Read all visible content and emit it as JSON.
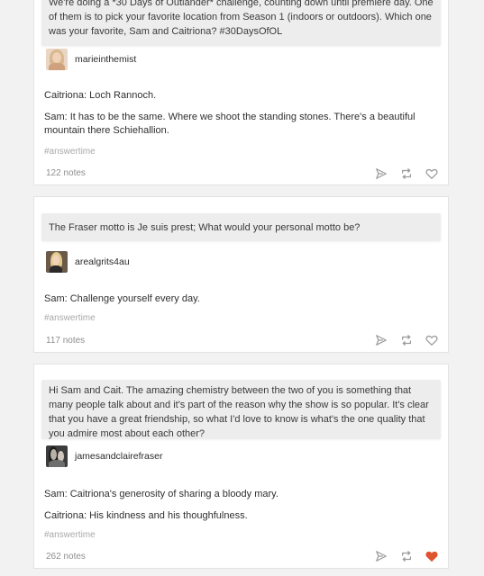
{
  "colors": {
    "background": "#f2f2f2",
    "card": "#ffffff",
    "ask_bubble": "#ededed",
    "tag": "#a8a8a8",
    "icon": "#9a9a9a",
    "liked_heart": "#e0532f"
  },
  "posts": [
    {
      "question": "We're doing a *30 Days of Outlander* challenge, counting down until premiere day. One of them is to pick your favorite location from Season 1 (indoors or outdoors). Which one was your favorite, Sam and Caitriona? #30DaysOfOL",
      "asker": "marieinthemist",
      "answers": [
        "Caitriona: Loch Rannoch.",
        "Sam: It has to be the same. Where we shoot the standing stones. There's a beautiful mountain there Schiehallion."
      ],
      "tag": "#answertime",
      "notes": "122 notes",
      "liked": false
    },
    {
      "question": "The Fraser motto is Je suis prest; What would your personal motto be?",
      "asker": "arealgrits4au",
      "answers": [
        "Sam: Challenge yourself every day."
      ],
      "tag": "#answertime",
      "notes": "117 notes",
      "liked": false
    },
    {
      "question": "Hi Sam and Cait. The amazing chemistry between the two of you is something that many people talk about and it's part of the reason why the show is so popular. It's clear that you have a great friendship, so what I'd love to know is what's the one quality that you admire most about each other?",
      "asker": "jamesandclairefraser",
      "answers": [
        "Sam: Caitriona's generosity of sharing a bloody mary.",
        "Caitriona: His kindness and his thoughfulness."
      ],
      "tag": "#answertime",
      "notes": "262 notes",
      "liked": true
    }
  ],
  "icons": {
    "share": "share-icon",
    "reblog": "reblog-icon",
    "like": "heart-icon"
  }
}
